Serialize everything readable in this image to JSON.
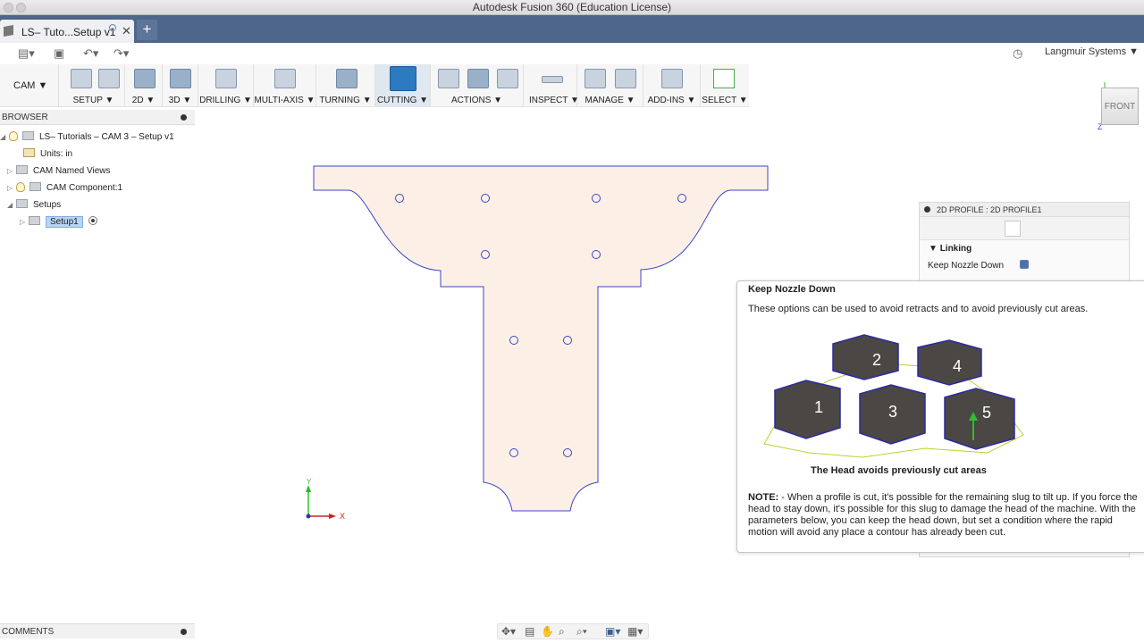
{
  "app": {
    "window_title": "Autodesk Fusion 360 (Education License)",
    "document_tab": "LS– Tuto...Setup v1",
    "new_tab": "+",
    "account": "Langmuir Systems ▼"
  },
  "ribbon": {
    "workspace": "CAM ▼",
    "groups": [
      "SETUP ▼",
      "2D ▼",
      "3D ▼",
      "DRILLING ▼",
      "MULTI-AXIS ▼",
      "TURNING ▼",
      "CUTTING ▼",
      "ACTIONS ▼",
      "INSPECT ▼",
      "MANAGE ▼",
      "ADD-INS ▼",
      "SELECT ▼"
    ]
  },
  "browser": {
    "header": "BROWSER",
    "root": "LS– Tutorials – CAM 3 – Setup v1",
    "units": "Units: in",
    "named_views": "CAM Named Views",
    "component": "CAM Component:1",
    "setups": "Setups",
    "setup1": "Setup1"
  },
  "comments": {
    "header": "COMMENTS"
  },
  "viewcube": {
    "face": "FRONT"
  },
  "triad": {
    "x": "X",
    "y": "Y",
    "z": "Z"
  },
  "panel": {
    "title": "2D PROFILE : 2D PROFILE1",
    "section": "Linking",
    "param": "Keep Nozzle Down",
    "param_checked": true
  },
  "tooltip": {
    "title": "Keep Nozzle Down",
    "description": "These options can be used to avoid retracts and to avoid previously cut areas.",
    "caption": "The Head avoids previously cut areas",
    "note_label": "NOTE:",
    "note_text": " - When a profile is cut, it's possible for the remaining slug to tilt up. If you force the head to stay down, it's possible for this slug to damage the head of the machine. With the parameters below, you can keep the head down, but set a condition where the rapid motion will avoid any place a contour has already been cut.",
    "hex_labels": [
      "1",
      "2",
      "3",
      "4",
      "5"
    ]
  },
  "colors": {
    "tab_bar": "#4e6689",
    "part_fill": "#fcf0e6",
    "part_outline": "#3a46c8",
    "hex_fill": "#4a4744",
    "hex_border": "#2e2aa0",
    "path_color": "#b9d234"
  }
}
